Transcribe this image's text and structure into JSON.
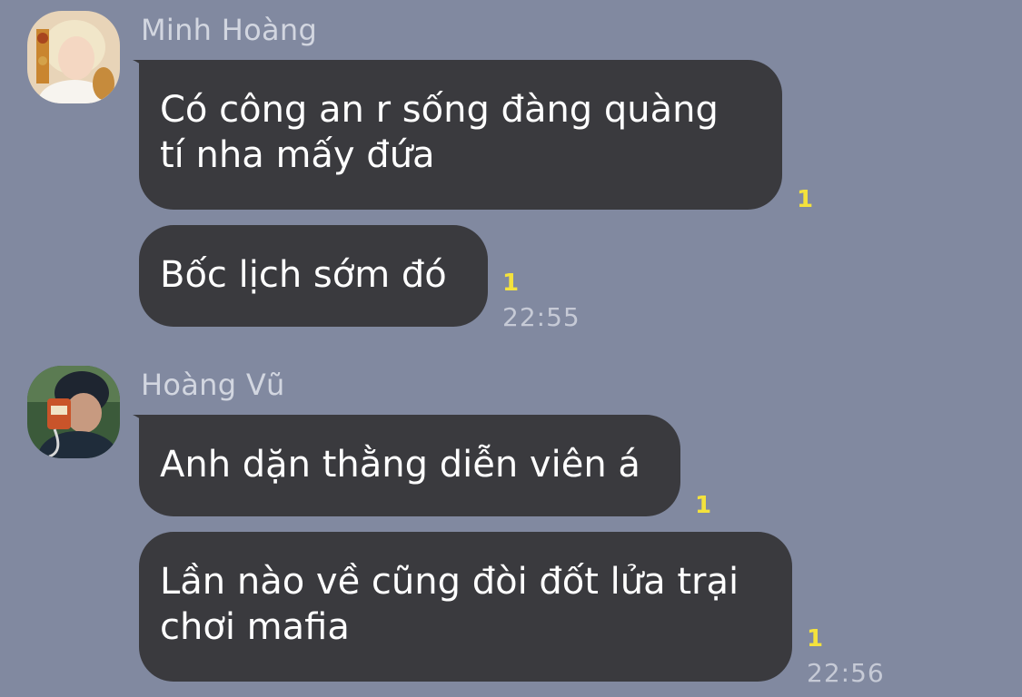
{
  "messages_group1": {
    "sender": "Minh Hoàng",
    "msg1": "Có công an r sống đàng quàng tí nha mấy đứa",
    "msg1_line1": "Có công an r sống đàng quàng",
    "msg1_line2": "tí nha mấy đứa",
    "msg1_unread": "1",
    "msg2": "Bốc lịch sớm đó",
    "msg2_unread": "1",
    "time": "22:55"
  },
  "messages_group2": {
    "sender": "Hoàng Vũ",
    "msg1": "Anh dặn thằng diễn viên á",
    "msg1_unread": "1",
    "msg2_line1": "Lần nào về cũng đòi đốt lửa trại",
    "msg2_line2": "chơi mafia",
    "msg2_unread": "1",
    "time": "22:56"
  },
  "colors": {
    "background": "#8189a0",
    "bubble": "#3a3a3e",
    "unread": "#f4e23c"
  },
  "icons": [
    "avatar-minh-hoang",
    "avatar-hoang-vu"
  ]
}
